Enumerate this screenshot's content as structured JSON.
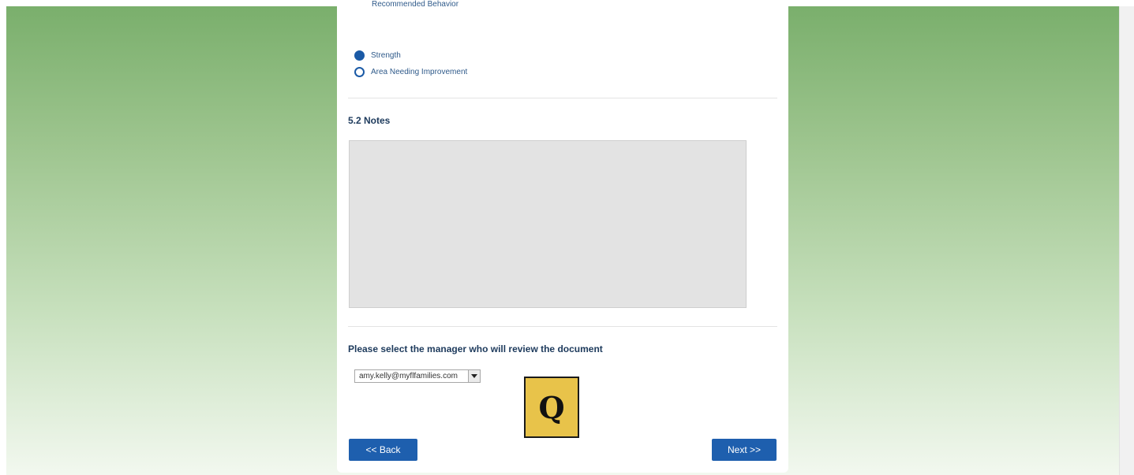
{
  "form": {
    "cut_off_text": "Recommended Behavior",
    "rating_options": [
      {
        "label": "Strength",
        "selected": true
      },
      {
        "label": "Area Needing Improvement",
        "selected": false
      }
    ],
    "notes": {
      "heading": "5.2 Notes",
      "value": ""
    },
    "manager_prompt": "Please select the manager who will review the document",
    "manager_select": {
      "selected": "amy.kelly@myflfamilies.com"
    },
    "back_label": "<< Back",
    "next_label": "Next >>"
  },
  "overlay_logo": {
    "letter": "Q",
    "color": "#e8c34a"
  },
  "colors": {
    "accent": "#1e5fae",
    "background_top": "#7aaf6c",
    "background_bottom": "#f2f8ef"
  }
}
